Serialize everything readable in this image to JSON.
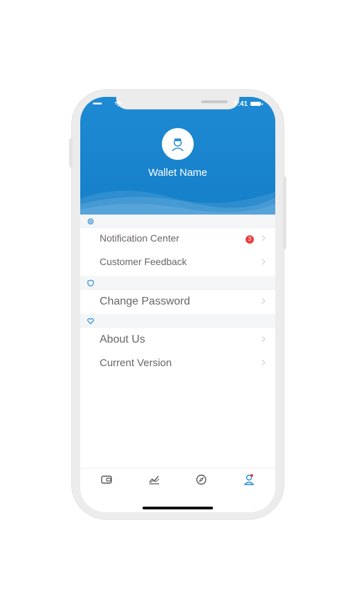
{
  "status_bar": {
    "signal": "•••••",
    "time": "9:41"
  },
  "header": {
    "wallet_name": "Wallet Name"
  },
  "sections": [
    {
      "icon": "settings-icon",
      "items": [
        {
          "label": "Notification Center",
          "badge": "3"
        },
        {
          "label": "Customer Feedback"
        }
      ]
    },
    {
      "icon": "shield-icon",
      "items": [
        {
          "label": "Change Password"
        }
      ]
    },
    {
      "icon": "heart-icon",
      "items": [
        {
          "label": "About Us"
        },
        {
          "label": "Current Version"
        }
      ]
    }
  ],
  "tabbar": [
    {
      "icon": "wallet-icon",
      "active": false
    },
    {
      "icon": "market-chart-icon",
      "active": false
    },
    {
      "icon": "discover-compass-icon",
      "active": false
    },
    {
      "icon": "profile-icon",
      "active": true
    }
  ],
  "colors": {
    "primary": "#1e8ad3",
    "badge": "#ea3c3c",
    "text": "#666666"
  }
}
